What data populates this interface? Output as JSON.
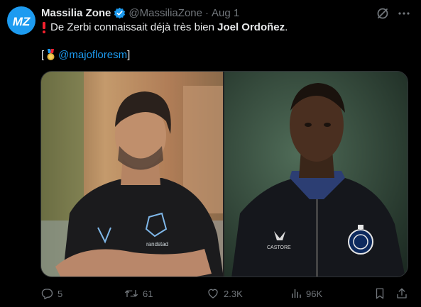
{
  "account": {
    "avatar_text": "MZ",
    "display_name": "Massilia Zone",
    "handle": "@MassiliaZone",
    "separator": "·",
    "date": "Aug 1"
  },
  "tweet": {
    "line1_prefix": "De Zerbi connaissait déjà très bien ",
    "line1_bold": "Joel Ordoñez",
    "line1_suffix": ".",
    "line2_open": "[",
    "line2_mention": "@majofloresm",
    "line2_close": "]"
  },
  "media": {
    "left_photo": {
      "crest_text": "randstad"
    },
    "right_photo": {
      "sponsor_text": "CASTORE"
    }
  },
  "actions": {
    "replies": "5",
    "reposts": "61",
    "likes": "2.3K",
    "views": "96K"
  },
  "colors": {
    "accent": "#1d9bf0",
    "background": "#000000",
    "muted": "#71767b",
    "alert": "#f4212e"
  }
}
